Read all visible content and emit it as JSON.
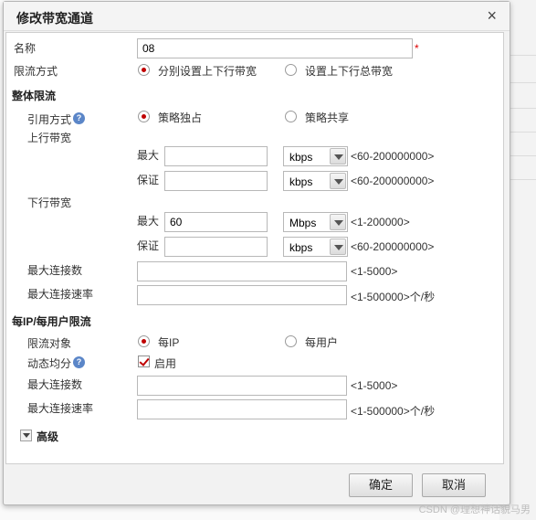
{
  "dialog": {
    "title": "修改带宽通道",
    "close_glyph": "×"
  },
  "form": {
    "name_label": "名称",
    "name_value": "08",
    "required_mark": "*",
    "limit_mode_label": "限流方式",
    "limit_mode_options": [
      "分别设置上下行带宽",
      "设置上下行总带宽"
    ],
    "overall_section": "整体限流",
    "ref_mode_label": "引用方式",
    "help_glyph": "?",
    "ref_mode_options": [
      "策略独占",
      "策略共享"
    ],
    "up_label": "上行带宽",
    "down_label": "下行带宽",
    "max_label": "最大",
    "guarantee_label": "保证",
    "up": {
      "max_value": "",
      "max_unit": "kbps",
      "max_range": "<60-200000000>",
      "guarantee_value": "",
      "guarantee_unit": "kbps",
      "guarantee_range": "<60-200000000>"
    },
    "down": {
      "max_value": "60",
      "max_unit": "Mbps",
      "max_range": "<1-200000>",
      "guarantee_value": "",
      "guarantee_unit": "kbps",
      "guarantee_range": "<60-200000000>"
    },
    "max_conn_label": "最大连接数",
    "max_conn_range": "<1-5000>",
    "max_rate_label": "最大连接速率",
    "max_rate_range": "<1-500000>个/秒",
    "perip_section": "每IP/每用户限流",
    "target_label": "限流对象",
    "target_options": [
      "每IP",
      "每用户"
    ],
    "dyn_label": "动态均分",
    "dyn_enable": "启用",
    "perip_max_conn_label": "最大连接数",
    "perip_max_conn_range": "<1-5000>",
    "perip_max_rate_label": "最大连接速率",
    "perip_max_rate_range": "<1-500000>个/秒",
    "advanced_label": "高级"
  },
  "buttons": {
    "ok": "确定",
    "cancel": "取消"
  },
  "watermark": "CSDN @理想神话貌马男",
  "colors": {
    "accent_radio": "#c00000",
    "help_icon": "#5b86c8"
  }
}
